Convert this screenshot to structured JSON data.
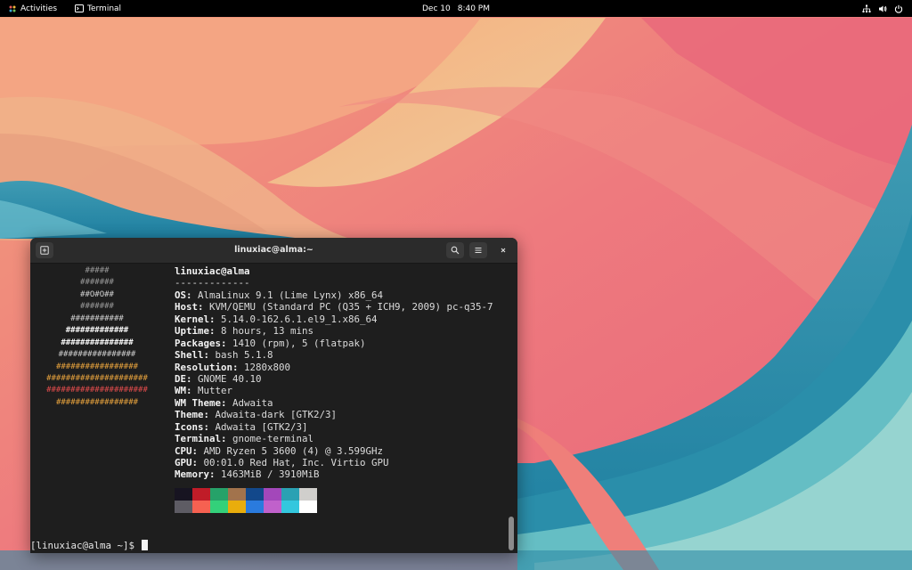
{
  "topbar": {
    "activities": "Activities",
    "app_name": "Terminal",
    "date": "Dec 10",
    "time": "8:40 PM",
    "icons": [
      "network-icon",
      "volume-icon",
      "power-icon"
    ]
  },
  "terminal": {
    "title": "linuxiac@alma:~",
    "buttons": [
      "new-tab-icon",
      "search-icon",
      "menu-icon",
      "close-icon"
    ],
    "ascii_logo": [
      "#####",
      "#######",
      "##O#O##",
      "#######",
      "###########",
      "#############",
      "###############",
      "################",
      "#################",
      "#####################",
      "#####################",
      "#################"
    ],
    "username_host": "linuxiac@alma",
    "separator": "-------------",
    "info": [
      {
        "key": "OS",
        "value": "AlmaLinux 9.1 (Lime Lynx) x86_64"
      },
      {
        "key": "Host",
        "value": "KVM/QEMU (Standard PC (Q35 + ICH9, 2009) pc-q35-7"
      },
      {
        "key": "Kernel",
        "value": "5.14.0-162.6.1.el9_1.x86_64"
      },
      {
        "key": "Uptime",
        "value": "8 hours, 13 mins"
      },
      {
        "key": "Packages",
        "value": "1410 (rpm), 5 (flatpak)"
      },
      {
        "key": "Shell",
        "value": "bash 5.1.8"
      },
      {
        "key": "Resolution",
        "value": "1280x800"
      },
      {
        "key": "DE",
        "value": "GNOME 40.10"
      },
      {
        "key": "WM",
        "value": "Mutter"
      },
      {
        "key": "WM Theme",
        "value": "Adwaita"
      },
      {
        "key": "Theme",
        "value": "Adwaita-dark [GTK2/3]"
      },
      {
        "key": "Icons",
        "value": "Adwaita [GTK2/3]"
      },
      {
        "key": "Terminal",
        "value": "gnome-terminal"
      },
      {
        "key": "CPU",
        "value": "AMD Ryzen 5 3600 (4) @ 3.599GHz"
      },
      {
        "key": "GPU",
        "value": "00:01.0 Red Hat, Inc. Virtio GPU"
      },
      {
        "key": "Memory",
        "value": "1463MiB / 3910MiB"
      }
    ],
    "palette_top": [
      "#171421",
      "#c01c28",
      "#26a269",
      "#a2734c",
      "#12488b",
      "#a347ba",
      "#2aa1b3",
      "#d0cfcc"
    ],
    "palette_bottom": [
      "#5e5c64",
      "#f66151",
      "#33d17a",
      "#e9ad0c",
      "#2a7bde",
      "#c061cb",
      "#33c7de",
      "#ffffff"
    ],
    "prompt": "[linuxiac@alma ~]$ "
  }
}
